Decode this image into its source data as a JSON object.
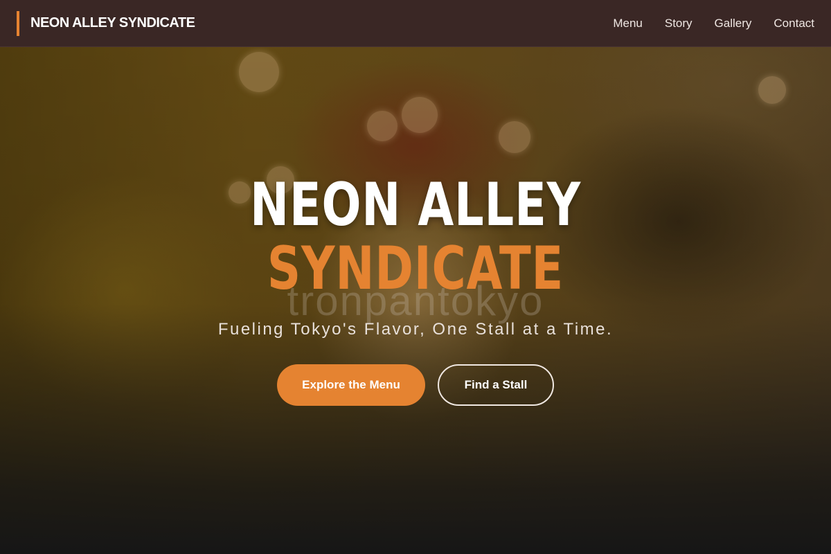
{
  "brand": {
    "name": "NEON ALLEY SYNDICATE",
    "accent_color": "#e58331"
  },
  "nav": {
    "items": [
      {
        "label": "Menu"
      },
      {
        "label": "Story"
      },
      {
        "label": "Gallery"
      },
      {
        "label": "Contact"
      }
    ]
  },
  "hero": {
    "title_line1": "NEON ALLEY",
    "title_line2": "SYNDICATE",
    "watermark": "tronpantokyo",
    "tagline": "Fueling Tokyo's Flavor, One Stall at a Time.",
    "primary_button": "Explore the Menu",
    "secondary_button": "Find a Stall"
  }
}
